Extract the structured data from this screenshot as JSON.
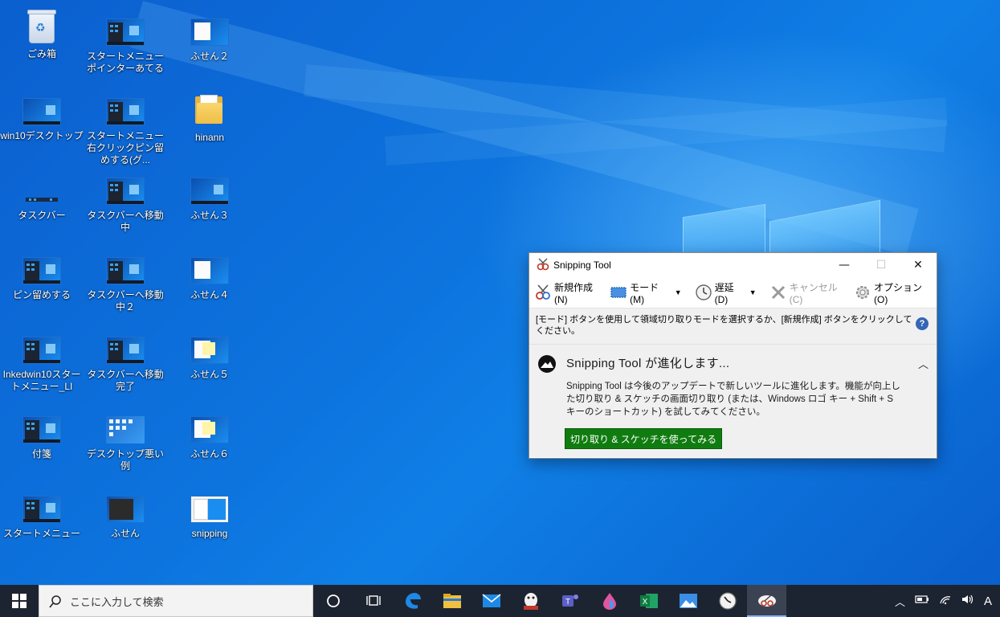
{
  "desktop": {
    "icons": [
      {
        "label": "ごみ箱"
      },
      {
        "label": "スタートメニューポインターあてる"
      },
      {
        "label": "ふせん２"
      },
      {
        "label": "win10デスクトップ"
      },
      {
        "label": "スタートメニュー右クリックピン留めする(グ..."
      },
      {
        "label": "hinann"
      },
      {
        "label": "タスクバー"
      },
      {
        "label": "タスクバーへ移動中"
      },
      {
        "label": "ふせん３"
      },
      {
        "label": "ピン留めする"
      },
      {
        "label": "タスクバーへ移動中２"
      },
      {
        "label": "ふせん４"
      },
      {
        "label": "Inkedwin10スタートメニュー_LI"
      },
      {
        "label": "タスクバーへ移動完了"
      },
      {
        "label": "ふせん５"
      },
      {
        "label": "付箋"
      },
      {
        "label": "デスクトップ悪い例"
      },
      {
        "label": "ふせん６"
      },
      {
        "label": "スタートメニュー"
      },
      {
        "label": "ふせん"
      },
      {
        "label": "snipping"
      }
    ]
  },
  "snipping_tool": {
    "title": "Snipping Tool",
    "toolbar": {
      "new": "新規作成(N)",
      "mode": "モード(M)",
      "delay": "遅延(D)",
      "cancel": "キャンセル(C)",
      "options": "オプション(O)"
    },
    "info": "[モード] ボタンを使用して領域切り取りモードを選択するか、[新規作成] ボタンをクリックしてください。",
    "promo": {
      "title": "Snipping  Tool が進化します...",
      "body": "Snipping Tool は今後のアップデートで新しいツールに進化します。機能が向上した切り取り & スケッチの画面切り取り (または、Windows ロゴ キー + Shift + S キーのショートカット) を試してみてください。",
      "button": "切り取り & スケッチを使ってみる"
    }
  },
  "taskbar": {
    "search_placeholder": "ここに入力して検索",
    "ime": "A"
  },
  "colors": {
    "desktop_blue": "#0a6fd6",
    "taskbar": "#1d2431",
    "promo_button": "#107c10"
  }
}
